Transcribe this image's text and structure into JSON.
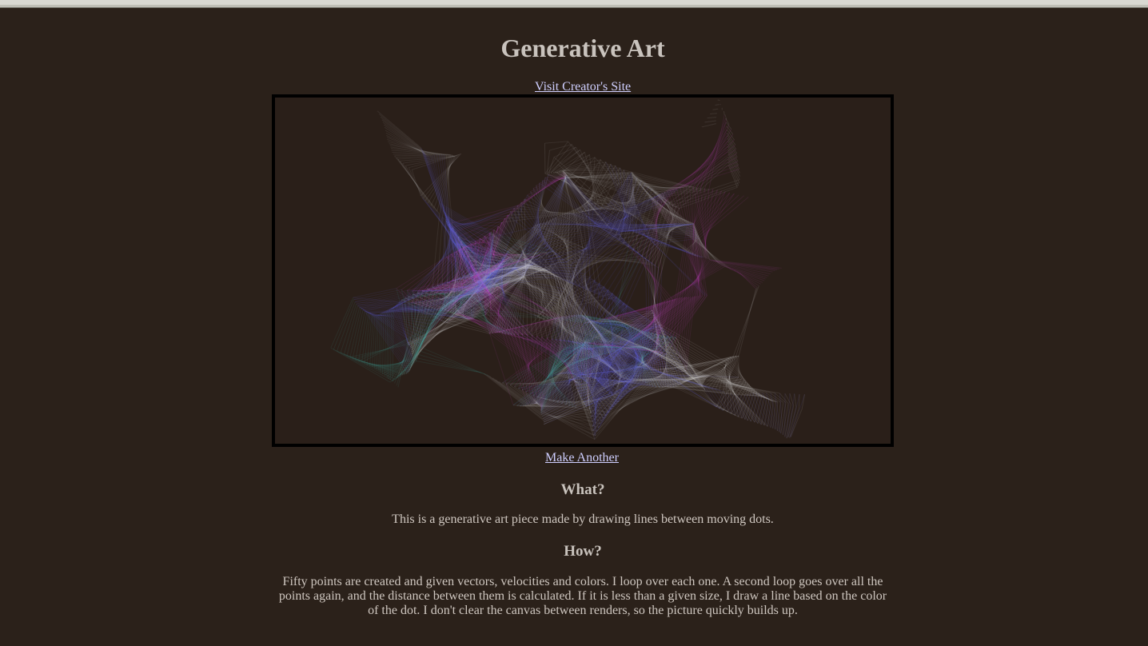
{
  "page": {
    "title": "Generative Art",
    "creator_link": "Visit Creator's Site",
    "make_another": "Make Another"
  },
  "what": {
    "heading": "What?",
    "text": "This is a generative art piece made by drawing lines between moving dots."
  },
  "how": {
    "heading": "How?",
    "text": "Fifty points are created and given vectors, velocities and colors. I loop over each one. A second loop goes over all the points again, and the distance between them is calculated. If it is less than a given size, I draw a line based on the color of the dot. I don't clear the canvas between renders, so the picture quickly builds up."
  },
  "colors": {
    "background": "#2b211a",
    "text": "#cfc7c0",
    "link": "#cfcfff",
    "canvas_border": "#000000",
    "art_palette": [
      "#b8b8b8",
      "#c040c0",
      "#6060e0",
      "#40b0a8",
      "#e0e0e0"
    ]
  }
}
